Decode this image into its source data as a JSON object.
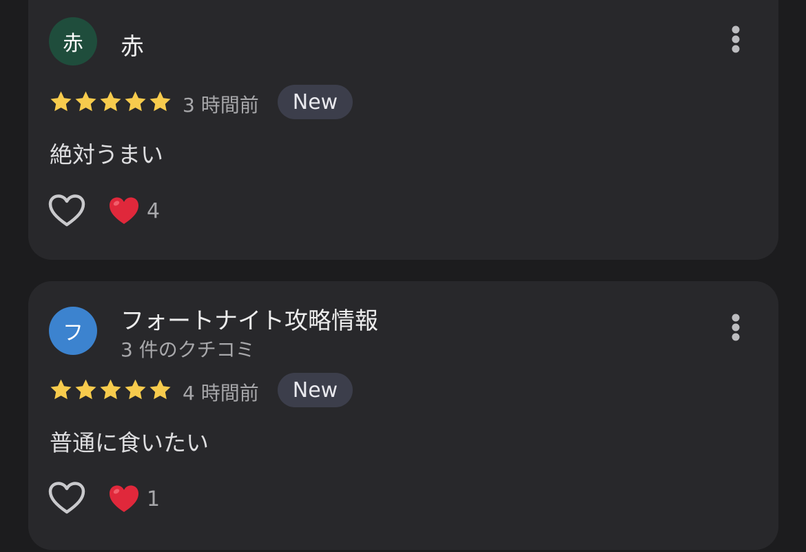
{
  "colors": {
    "background": "#1c1c1e",
    "card": "#28282b",
    "star": "#f7cb4d",
    "badge": "#3c3e4b",
    "avatar_green": "#1f4d3c",
    "avatar_blue": "#3c83cf"
  },
  "reviews": [
    {
      "avatar_letter": "赤",
      "avatar_color": "#1f4d3c",
      "author": "赤",
      "author_subtitle": "",
      "rating": 5,
      "time": "3 時間前",
      "badge": "New",
      "text": "絶対うまい",
      "like_icon": "heart-outline-icon",
      "reaction_icon": "red-heart-emoji",
      "reaction_count": "4",
      "menu_icon": "more-vertical-icon"
    },
    {
      "avatar_letter": "フ",
      "avatar_color": "#3c83cf",
      "author": "フォートナイト攻略情報",
      "author_subtitle": "3 件のクチコミ",
      "rating": 5,
      "time": "4 時間前",
      "badge": "New",
      "text": "普通に食いたい",
      "like_icon": "heart-outline-icon",
      "reaction_icon": "red-heart-emoji",
      "reaction_count": "1",
      "menu_icon": "more-vertical-icon"
    }
  ]
}
